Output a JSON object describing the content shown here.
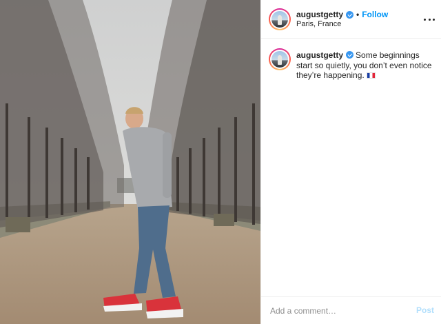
{
  "post": {
    "username": "augustgetty",
    "verified": true,
    "separator": "•",
    "follow_label": "Follow",
    "location": "Paris, France",
    "more_icon": "more-horizontal-icon",
    "caption": {
      "username": "augustgetty",
      "text": "Some beginnings start so quietly, you don’t even notice they’re happening."
    },
    "comment": {
      "placeholder": "Add a comment…",
      "post_label": "Post"
    }
  },
  "colors": {
    "link_blue": "#0095f6",
    "verified_blue": "#3897f0",
    "post_disabled": "#b2dffc",
    "border": "#efefef"
  }
}
